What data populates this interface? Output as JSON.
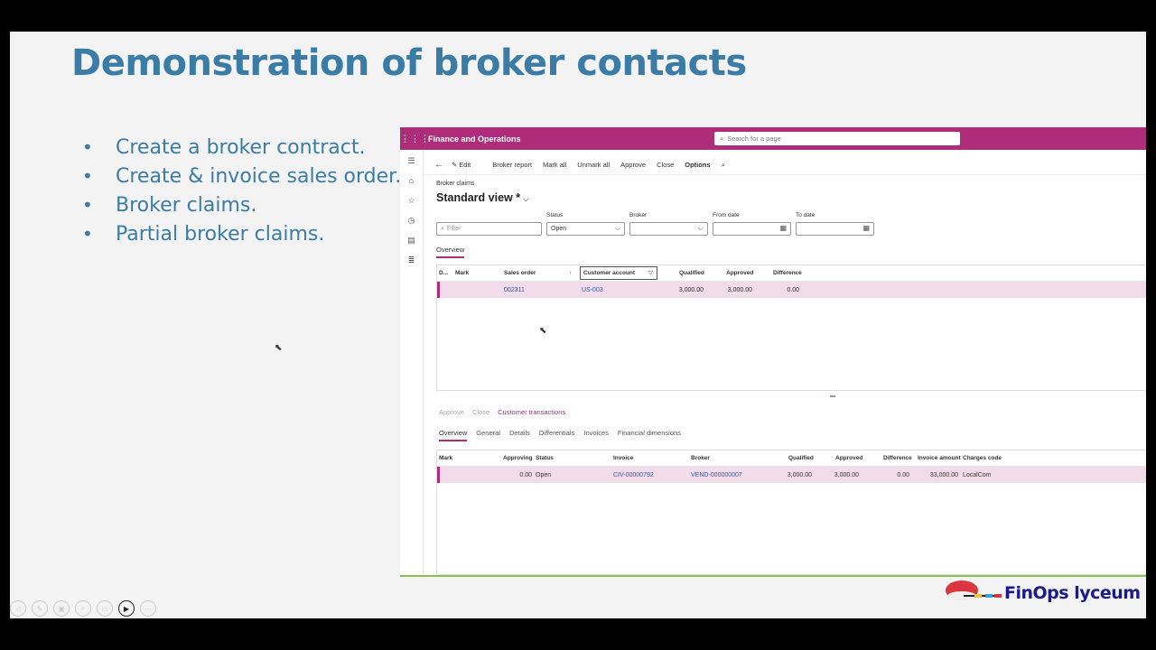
{
  "slide": {
    "title": "Demonstration of broker contacts",
    "bullets": [
      "Create a broker contract.",
      "Create & invoice sales order.",
      "Broker claims.",
      "Partial broker claims."
    ]
  },
  "app": {
    "name": "Finance and Operations",
    "search_placeholder": "Search for a page",
    "actions": {
      "edit": "Edit",
      "broker_report": "Broker report",
      "mark_all": "Mark all",
      "unmark_all": "Unmark all",
      "approve": "Approve",
      "close": "Close",
      "options": "Options"
    },
    "breadcrumb": "Broker claims",
    "view_name": "Standard view *",
    "filters": {
      "filter_placeholder": "Filter",
      "status_label": "Status",
      "status_value": "Open",
      "broker_label": "Broker",
      "broker_value": "",
      "from_date_label": "From date",
      "to_date_label": "To date"
    },
    "tab_overview": "Overview",
    "grid1": {
      "headers": {
        "d": "D...",
        "mark": "Mark",
        "sales_order": "Sales order",
        "customer_account": "Customer account",
        "qualified": "Qualified",
        "approved": "Approved",
        "difference": "Difference"
      },
      "row": {
        "sales_order": "002311",
        "customer_account": "US-003",
        "qualified": "3,000.00",
        "approved": "3,000.00",
        "difference": "0.00"
      }
    },
    "sub_actions": {
      "approve": "Approve",
      "close": "Close",
      "customer_transactions": "Customer transactions"
    },
    "tabs2": [
      "Overview",
      "General",
      "Details",
      "Differentials",
      "Invoices",
      "Financial dimensions"
    ],
    "grid2": {
      "headers": {
        "mark": "Mark",
        "approving": "Approving",
        "status": "Status",
        "invoice": "Invoice",
        "broker": "Broker",
        "qualified": "Qualified",
        "approved": "Approved",
        "difference": "Difference",
        "invoice_amount": "Invoice amount",
        "charges_code": "Charges code"
      },
      "row": {
        "approving": "0.00",
        "status": "Open",
        "invoice": "CIV-00000792",
        "broker": "VEND-000000007",
        "qualified": "3,000.00",
        "approved": "3,000.00",
        "difference": "0.00",
        "invoice_amount": "33,000.00",
        "charges_code": "LocalCom"
      }
    }
  },
  "logo": {
    "text": "FinOps lyceum"
  }
}
